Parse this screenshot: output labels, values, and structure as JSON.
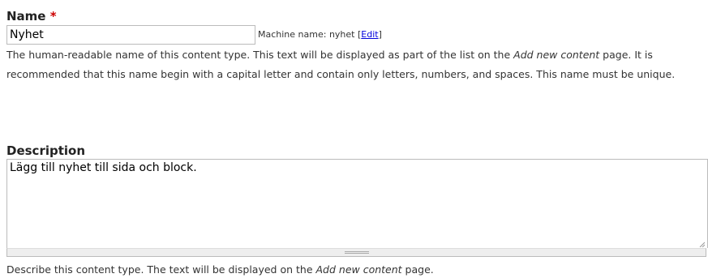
{
  "name_field": {
    "label": "Name",
    "required_mark": "*",
    "value": "Nyhet",
    "machine_name_prefix": "Machine name: nyhet",
    "machine_name_bracket_open": "[",
    "edit_link": "Edit",
    "machine_name_bracket_close": "]",
    "help_part1": "The human-readable name of this content type. This text will be displayed as part of the list on the ",
    "help_emphasis": "Add new content",
    "help_part2": " page. It is recommended that this name begin with a capital letter and contain only letters, numbers, and spaces. This name must be unique."
  },
  "description_field": {
    "label": "Description",
    "value": "Lägg till nyhet till sida och block.",
    "help_part1": "Describe this content type. The text will be displayed on the ",
    "help_emphasis": "Add new content",
    "help_part2": " page."
  },
  "icons": {
    "resize": "resize-grip-icon"
  },
  "colors": {
    "required": "#cc0000",
    "link": "#0000dd",
    "border": "#bbbbbb"
  }
}
